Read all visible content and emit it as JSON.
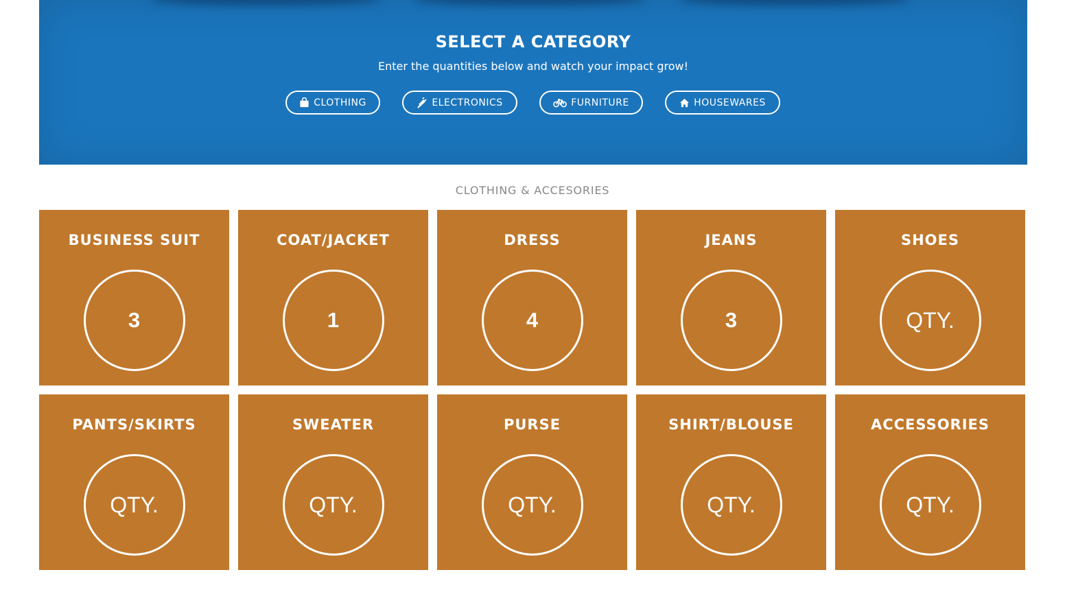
{
  "hero": {
    "title": "SELECT A CATEGORY",
    "subtitle": "Enter the quantities below and watch your impact grow!",
    "categories": [
      {
        "label": "CLOTHING",
        "icon": "shopping-bag-icon"
      },
      {
        "label": "ELECTRONICS",
        "icon": "plug-icon"
      },
      {
        "label": "FURNITURE",
        "icon": "bicycle-icon"
      },
      {
        "label": "HOUSEWARES",
        "icon": "home-icon"
      }
    ]
  },
  "section": {
    "title": "CLOTHING & ACCESORIES"
  },
  "items": [
    {
      "name": "BUSINESS SUIT",
      "value": "3",
      "placeholder": "QTY."
    },
    {
      "name": "COAT/JACKET",
      "value": "1",
      "placeholder": "QTY."
    },
    {
      "name": "DRESS",
      "value": "4",
      "placeholder": "QTY."
    },
    {
      "name": "JEANS",
      "value": "3",
      "placeholder": "QTY."
    },
    {
      "name": "SHOES",
      "value": "",
      "placeholder": "QTY."
    },
    {
      "name": "PANTS/SKIRTS",
      "value": "",
      "placeholder": "QTY."
    },
    {
      "name": "SWEATER",
      "value": "",
      "placeholder": "QTY."
    },
    {
      "name": "PURSE",
      "value": "",
      "placeholder": "QTY."
    },
    {
      "name": "SHIRT/BLOUSE",
      "value": "",
      "placeholder": "QTY."
    },
    {
      "name": "ACCESSORIES",
      "value": "",
      "placeholder": "QTY."
    }
  ],
  "colors": {
    "hero_blue": "#1b75bc",
    "tile_orange": "#c0782c",
    "section_gray": "#888888"
  }
}
